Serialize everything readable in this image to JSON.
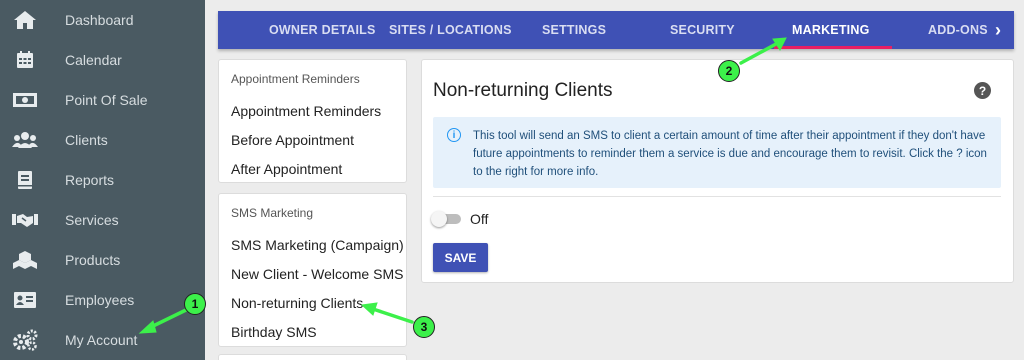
{
  "sidebar": {
    "items": [
      {
        "label": "Dashboard",
        "icon": "home-icon"
      },
      {
        "label": "Calendar",
        "icon": "calendar-icon"
      },
      {
        "label": "Point Of Sale",
        "icon": "money-icon"
      },
      {
        "label": "Clients",
        "icon": "users-icon"
      },
      {
        "label": "Reports",
        "icon": "book-icon"
      },
      {
        "label": "Services",
        "icon": "handshake-icon"
      },
      {
        "label": "Products",
        "icon": "cubes-icon"
      },
      {
        "label": "Employees",
        "icon": "id-card-icon"
      },
      {
        "label": "My Account",
        "icon": "gears-icon"
      }
    ]
  },
  "tabs": {
    "items": [
      {
        "label": "OWNER DETAILS"
      },
      {
        "label": "SITES / LOCATIONS"
      },
      {
        "label": "SETTINGS"
      },
      {
        "label": "SECURITY"
      },
      {
        "label": "MARKETING"
      },
      {
        "label": "ADD-ONS"
      }
    ],
    "active": "MARKETING",
    "arrow": "›"
  },
  "menu": {
    "reminders": {
      "header": "Appointment Reminders",
      "items": [
        "Appointment Reminders",
        "Before Appointment",
        "After Appointment"
      ]
    },
    "sms": {
      "header": "SMS Marketing",
      "items": [
        "SMS Marketing (Campaign)",
        "New Client - Welcome SMS",
        "Non-returning Clients",
        "Birthday SMS"
      ]
    }
  },
  "panel": {
    "title": "Non-returning Clients",
    "help": "?",
    "info_icon": "i",
    "info": "This tool will send an SMS to client a certain amount of time after their appointment if they don't have future appointments to reminder them a service is due and encourage them to revisit. Click the ? icon to the right for more info.",
    "toggle_label": "Off",
    "save_label": "SAVE"
  },
  "annotations": [
    "1",
    "2",
    "3"
  ],
  "colors": {
    "sidebar_bg": "#4a5a62",
    "tabbar_bg": "#3f51b5",
    "active_underline": "#e91e63",
    "marker": "#3cf04a",
    "info_bg": "#e6f1fb"
  }
}
